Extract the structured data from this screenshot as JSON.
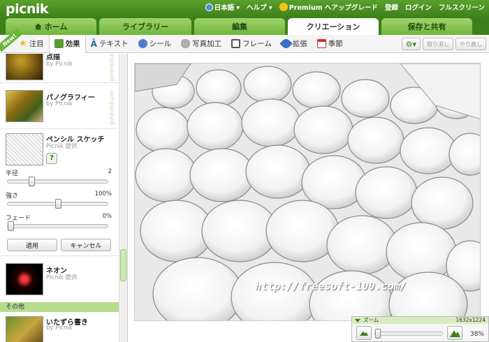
{
  "app": {
    "logo": "picnik"
  },
  "toplinks": {
    "language": "日本語 ▾",
    "help": "ヘルプ ▾",
    "premium_upgrade": "Premium へアップグレード",
    "register": "登録",
    "login": "ログイン",
    "fullscreen": "フルスクリーン"
  },
  "tabs": [
    {
      "label": "ホーム"
    },
    {
      "label": "ライブラリー"
    },
    {
      "label": "編集"
    },
    {
      "label": "クリエーション"
    },
    {
      "label": "保存と共有"
    }
  ],
  "subnav": {
    "new_badge": "New!",
    "items": [
      {
        "label": "注目"
      },
      {
        "label": "効果"
      },
      {
        "label": "テキスト"
      },
      {
        "label": "シール"
      },
      {
        "label": "写真加工"
      },
      {
        "label": "フレーム"
      },
      {
        "label": "拡張"
      },
      {
        "label": "季節"
      }
    ],
    "undo": "取り消し",
    "redo": "やり直し"
  },
  "effects": {
    "item1": {
      "name": "点描",
      "by": "by Picnik",
      "badge": "premium"
    },
    "item2": {
      "name": "パノグラフィー",
      "by": "by Picnik",
      "badge": "premium"
    },
    "pencil": {
      "name": "ペンシル スケッチ",
      "by": "Picnik 提供",
      "help": "?",
      "sliders": [
        {
          "label": "半径",
          "value": "2",
          "fraction": 0.22
        },
        {
          "label": "強さ",
          "value": "100%",
          "fraction": 0.5
        },
        {
          "label": "フェード",
          "value": "0%",
          "fraction": 0.0
        }
      ],
      "apply": "適用",
      "cancel": "キャンセル"
    },
    "neon": {
      "name": "ネオン",
      "by": "Picnik 提供"
    },
    "section_other": "その他",
    "doodle": {
      "name": "いたずら書き",
      "by": "by Picnik"
    }
  },
  "canvas": {
    "watermark": "http://freesoft-100.com/"
  },
  "zoom": {
    "label": "ズーム",
    "dimensions": "1632x1224",
    "percent": "38%",
    "fraction": 0.0
  }
}
